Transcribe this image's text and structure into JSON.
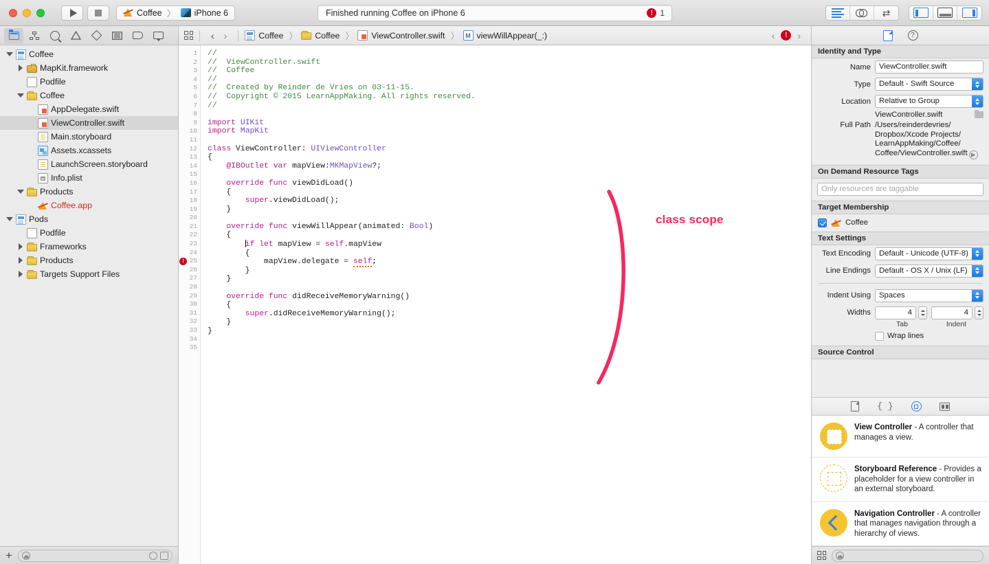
{
  "titlebar": {
    "run_label": "run-button",
    "stop_label": "stop-button",
    "scheme_name": "Coffee",
    "scheme_separator": "〉",
    "destination": "iPhone 6",
    "status_text": "Finished running Coffee on iPhone 6",
    "error_badge": "!",
    "error_count": "1"
  },
  "navigator": {
    "tabs": [
      "project-navigator",
      "symbol-navigator",
      "find-navigator",
      "issue-navigator",
      "test-navigator",
      "debug-navigator",
      "breakpoint-navigator",
      "report-navigator"
    ],
    "tree": [
      {
        "label": "Coffee",
        "indent": 0,
        "twisty": "open",
        "icon": "project"
      },
      {
        "label": "MapKit.framework",
        "indent": 1,
        "twisty": "closed",
        "icon": "framework"
      },
      {
        "label": "Podfile",
        "indent": 1,
        "twisty": "none",
        "icon": "file"
      },
      {
        "label": "Coffee",
        "indent": 1,
        "twisty": "open",
        "icon": "folder"
      },
      {
        "label": "AppDelegate.swift",
        "indent": 2,
        "twisty": "none",
        "icon": "swift"
      },
      {
        "label": "ViewController.swift",
        "indent": 2,
        "twisty": "none",
        "icon": "swift",
        "selected": true
      },
      {
        "label": "Main.storyboard",
        "indent": 2,
        "twisty": "none",
        "icon": "storyboard"
      },
      {
        "label": "Assets.xcassets",
        "indent": 2,
        "twisty": "none",
        "icon": "assets"
      },
      {
        "label": "LaunchScreen.storyboard",
        "indent": 2,
        "twisty": "none",
        "icon": "storyboard"
      },
      {
        "label": "Info.plist",
        "indent": 2,
        "twisty": "none",
        "icon": "plist"
      },
      {
        "label": "Products",
        "indent": 1,
        "twisty": "open",
        "icon": "folder"
      },
      {
        "label": "Coffee.app",
        "indent": 2,
        "twisty": "none",
        "icon": "app",
        "red": true
      },
      {
        "label": "Pods",
        "indent": 0,
        "twisty": "open",
        "icon": "project"
      },
      {
        "label": "Podfile",
        "indent": 1,
        "twisty": "none",
        "icon": "file"
      },
      {
        "label": "Frameworks",
        "indent": 1,
        "twisty": "closed",
        "icon": "folder"
      },
      {
        "label": "Products",
        "indent": 1,
        "twisty": "closed",
        "icon": "folder"
      },
      {
        "label": "Targets Support Files",
        "indent": 1,
        "twisty": "closed",
        "icon": "folder"
      }
    ],
    "footer": {
      "add_label": "+",
      "filter_placeholder": ""
    }
  },
  "jumpbar": {
    "back": "‹",
    "forward": "›",
    "crumbs": [
      {
        "label": "Coffee",
        "icon": "project"
      },
      {
        "label": "Coffee",
        "icon": "folder"
      },
      {
        "label": "ViewController.swift",
        "icon": "swift"
      },
      {
        "label": "viewWillAppear(_:)",
        "icon": "method"
      }
    ],
    "error_badge": "!"
  },
  "editor": {
    "line_numbers": [
      1,
      2,
      3,
      4,
      5,
      6,
      7,
      8,
      9,
      10,
      11,
      12,
      13,
      14,
      15,
      16,
      17,
      18,
      19,
      20,
      21,
      22,
      23,
      24,
      25,
      26,
      27,
      28,
      29,
      30,
      31,
      32,
      33,
      34,
      35
    ],
    "error_line": 25,
    "breakpoint_line": 14,
    "code_lines": [
      "//",
      "//  ViewController.swift",
      "//  Coffee",
      "//",
      "//  Created by Reinder de Vries on 03-11-15.",
      "//  Copyright © 2015 LearnAppMaking. All rights reserved.",
      "//",
      "",
      "import UIKit",
      "import MapKit",
      "",
      "class ViewController: UIViewController",
      "{",
      "    @IBOutlet var mapView:MKMapView?;",
      "",
      "    override func viewDidLoad()",
      "    {",
      "        super.viewDidLoad();",
      "    }",
      "",
      "    override func viewWillAppear(animated: Bool)",
      "    {",
      "        if let mapView = self.mapView",
      "        {",
      "            mapView.delegate = self;",
      "        }",
      "    }",
      "",
      "    override func didReceiveMemoryWarning()",
      "    {",
      "        super.didReceiveMemoryWarning();",
      "    }",
      "}",
      "",
      ""
    ],
    "annotation": {
      "text": "class scope",
      "color": "#f7285f"
    }
  },
  "inspector": {
    "tabs": [
      "file-inspector",
      "quick-help-inspector"
    ],
    "identity": {
      "header": "Identity and Type",
      "name_label": "Name",
      "name_value": "ViewController.swift",
      "type_label": "Type",
      "type_value": "Default - Swift Source",
      "location_label": "Location",
      "location_value": "Relative to Group",
      "location_file": "ViewController.swift",
      "fullpath_label": "Full Path",
      "fullpath_lines": [
        "/Users/reinderdevries/",
        "Dropbox/Xcode Projects/",
        "LearnAppMaking/Coffee/",
        "Coffee/ViewController.swift"
      ]
    },
    "ondemand": {
      "header": "On Demand Resource Tags",
      "placeholder": "Only resources are taggable"
    },
    "target": {
      "header": "Target Membership",
      "items": [
        {
          "label": "Coffee",
          "checked": true
        }
      ]
    },
    "text_settings": {
      "header": "Text Settings",
      "encoding_label": "Text Encoding",
      "encoding_value": "Default - Unicode (UTF-8)",
      "endings_label": "Line Endings",
      "endings_value": "Default - OS X / Unix (LF)",
      "indent_label": "Indent Using",
      "indent_value": "Spaces",
      "widths_label": "Widths",
      "tab_value": "4",
      "indent_width_value": "4",
      "tab_caption": "Tab",
      "indent_caption": "Indent",
      "wrap_label": "Wrap lines",
      "wrap_checked": false
    },
    "source_control": {
      "header": "Source Control"
    },
    "library": {
      "tabs": [
        "file-template-library",
        "code-snippet-library",
        "object-library",
        "media-library"
      ],
      "items": [
        {
          "title": "View Controller",
          "desc": " - A controller that manages a view.",
          "icon": "view-controller"
        },
        {
          "title": "Storyboard Reference",
          "desc": " - Provides a placeholder for a view controller in an external storyboard.",
          "icon": "storyboard-reference"
        },
        {
          "title": "Navigation Controller",
          "desc": " - A controller that manages navigation through a hierarchy of views.",
          "icon": "navigation-controller"
        }
      ]
    }
  }
}
